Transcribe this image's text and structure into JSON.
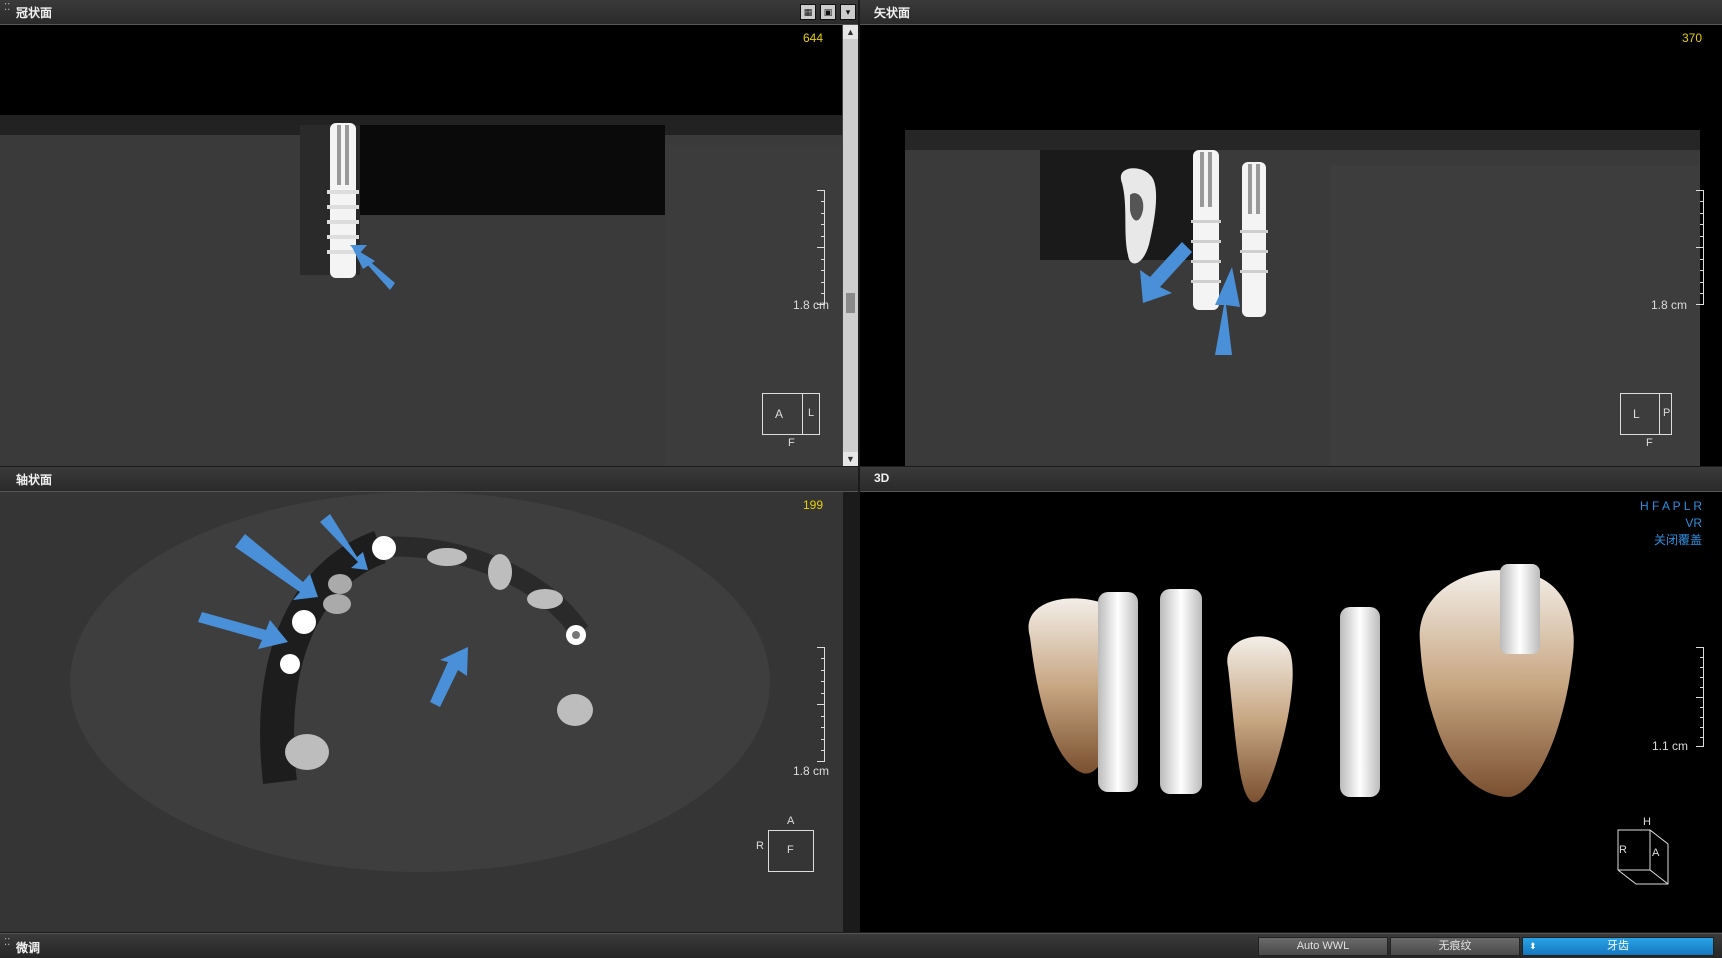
{
  "panels": {
    "coronal": {
      "title": "冠状面",
      "slice": "644",
      "scale_label": "1.8 cm",
      "orient": {
        "center": "A",
        "right": "L",
        "bottom": "F"
      }
    },
    "sagittal": {
      "title": "矢状面",
      "slice": "370",
      "scale_label": "1.8 cm",
      "orient": {
        "center": "L",
        "right": "P",
        "bottom": "F"
      }
    },
    "axial": {
      "title": "轴状面",
      "slice": "199",
      "scale_label": "1.8 cm",
      "orient": {
        "center": "F",
        "left": "R",
        "top": "A"
      }
    },
    "threed": {
      "title": "3D",
      "overlay_line1": "H F A P L R",
      "overlay_line2": "VR",
      "overlay_line3": "关闭覆盖",
      "scale_label": "1.1 cm",
      "orient": {
        "top": "H",
        "left": "R",
        "right": "A"
      }
    }
  },
  "bottom_bar": {
    "title": "微调",
    "buttons": [
      {
        "label": "Auto WWL"
      },
      {
        "label": "无痕纹"
      },
      {
        "label": "牙齿"
      }
    ]
  },
  "colors": {
    "accent": "#1577c0",
    "slice_number": "#e8d000",
    "arrow": "#4a90d9",
    "overlay_text": "#2f8fe0"
  }
}
